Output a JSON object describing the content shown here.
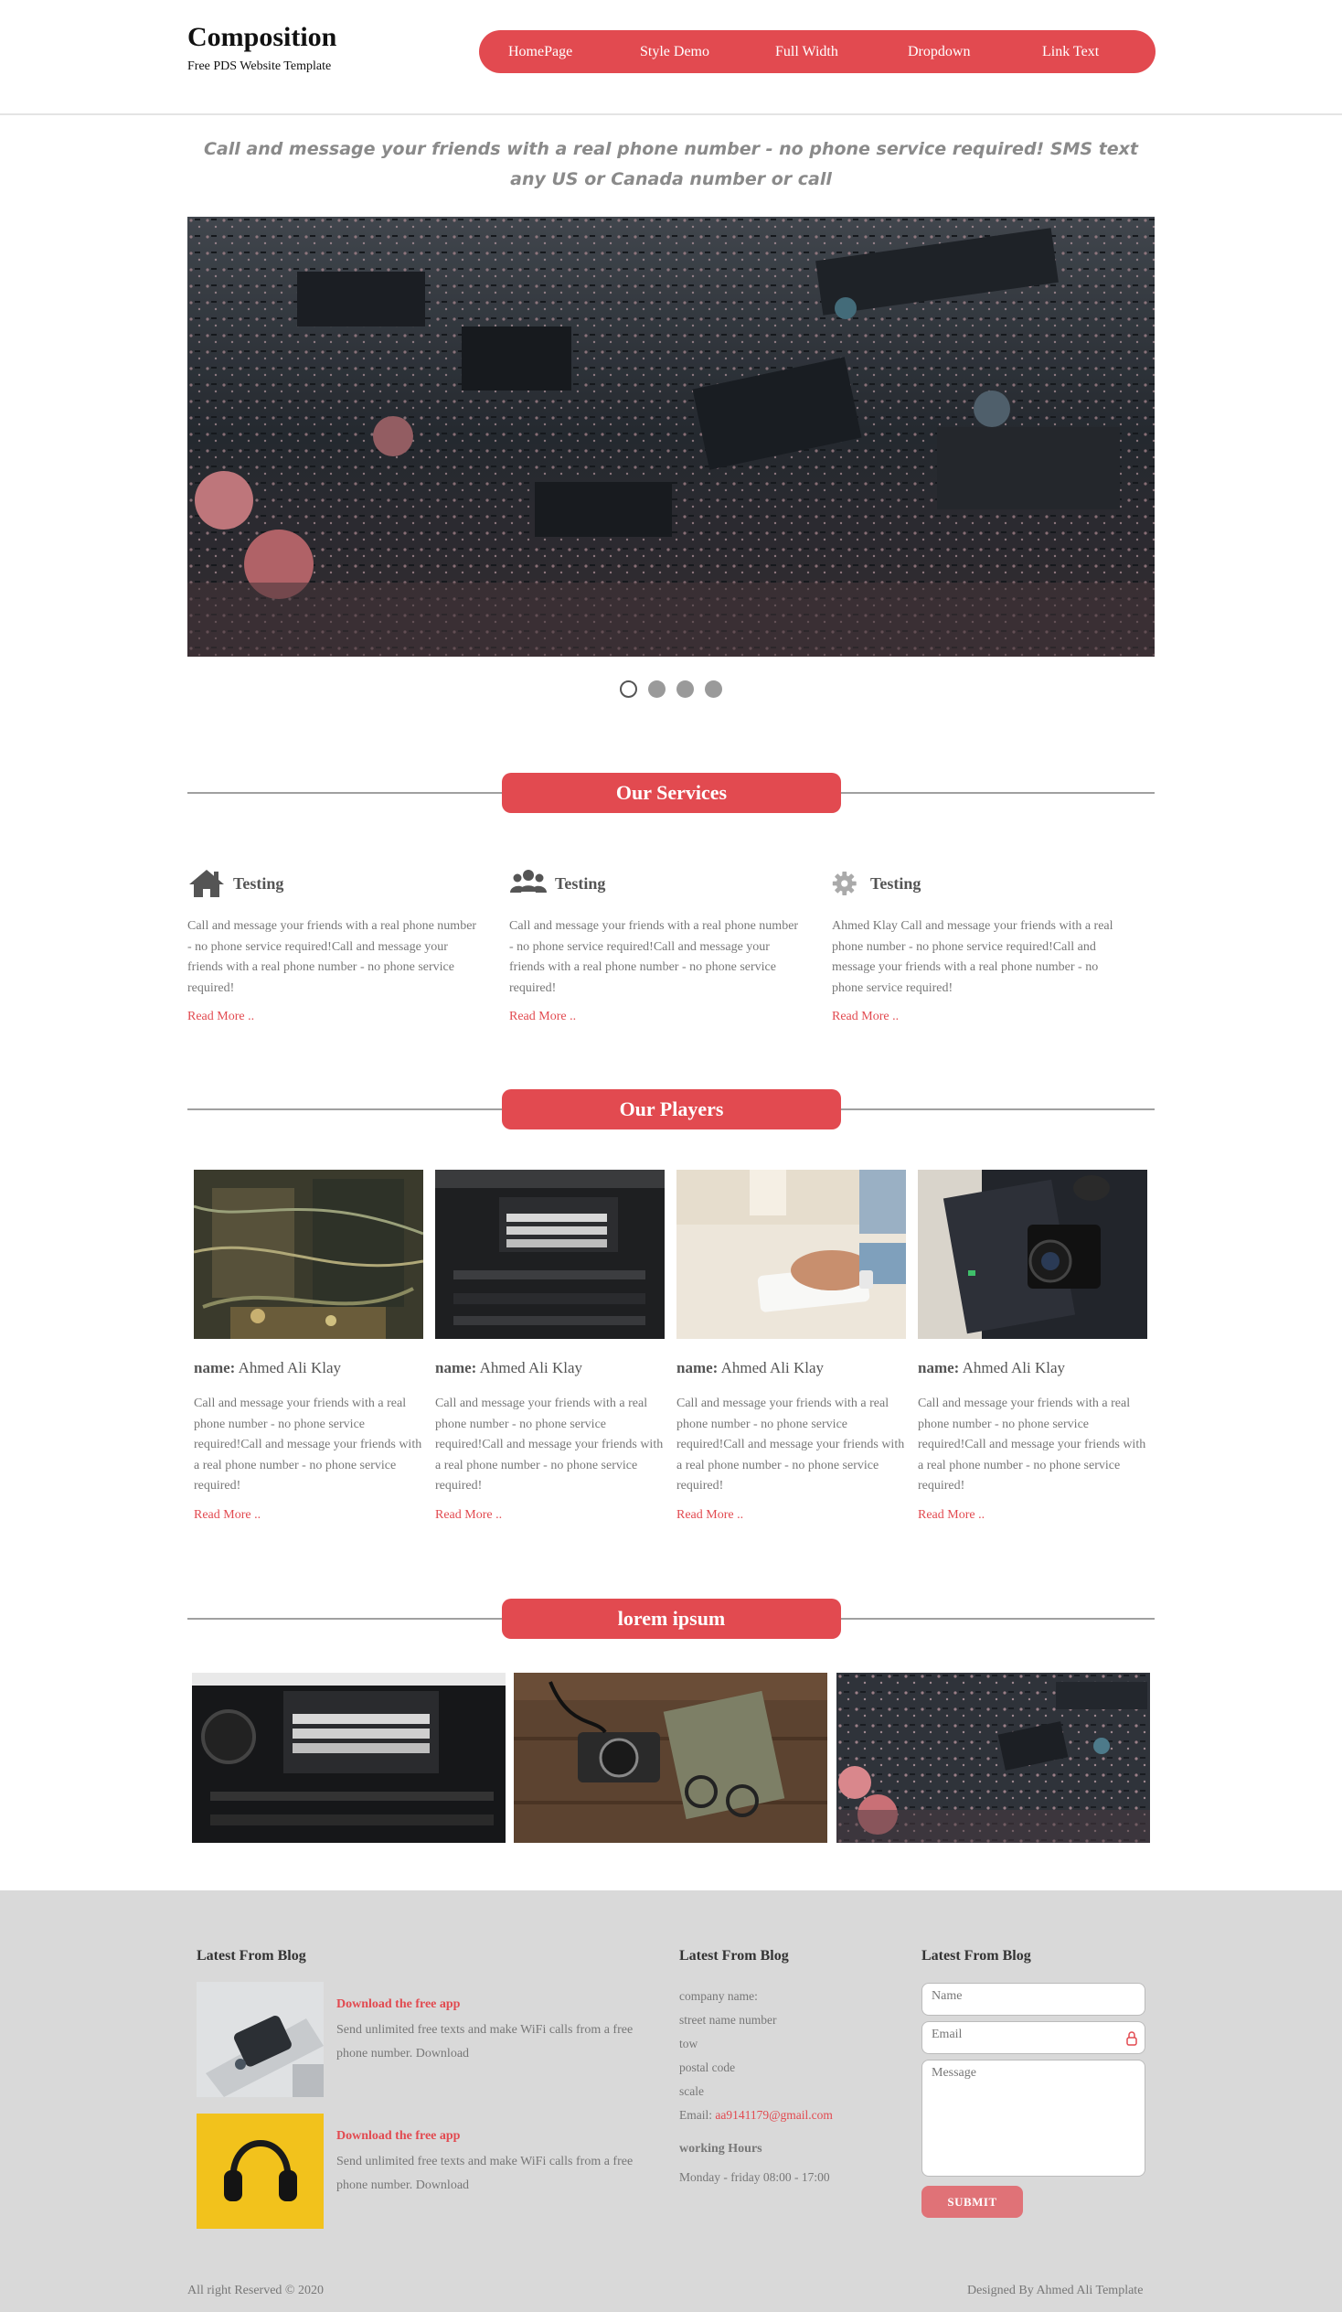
{
  "brand": {
    "title": "Composition",
    "subtitle": "Free PDS Website Template"
  },
  "nav": [
    "HomePage",
    "Style Demo",
    "Full Width",
    "Dropdown",
    "Link Text"
  ],
  "tagline": "Call and message your friends with a real phone number - no phone service required! SMS text any US or Canada number or call",
  "slider": {
    "dots": 4,
    "active_index": 0
  },
  "services": {
    "heading": "Our Services",
    "items": [
      {
        "icon": "home-icon",
        "title": "Testing",
        "text": "Call and message your friends with a real phone number - no phone service required!Call and message your friends with a real phone number - no phone service required!",
        "link": "Read More .."
      },
      {
        "icon": "users-icon",
        "title": "Testing",
        "text": "Call and message your friends with a real phone number - no phone service required!Call and message your friends with a real phone number - no phone service required!",
        "link": "Read More .."
      },
      {
        "icon": "gear-icon",
        "title": "Testing",
        "text": "Ahmed Klay Call and message your friends with a real phone number - no phone service required!Call and message your friends with a real phone number - no phone service required!",
        "link": "Read More .."
      }
    ]
  },
  "players": {
    "heading": "Our Players",
    "items": [
      {
        "label": "name:",
        "name": "Ahmed Ali Klay",
        "text": "Call and message your friends with a real phone number - no phone service required!Call and message your friends with a real phone number - no phone service required!",
        "link": "Read More .."
      },
      {
        "label": "name:",
        "name": "Ahmed Ali Klay",
        "text": "Call and message your friends with a real phone number - no phone service required!Call and message your friends with a real phone number - no phone service required!",
        "link": "Read More .."
      },
      {
        "label": "name:",
        "name": "Ahmed Ali Klay",
        "text": "Call and message your friends with a real phone number - no phone service required!Call and message your friends with a real phone number - no phone service required!",
        "link": "Read More .."
      },
      {
        "label": "name:",
        "name": "Ahmed Ali Klay",
        "text": "Call and message your friends with a real phone number - no phone service required!Call and message your friends with a real phone number - no phone service required!",
        "link": "Read More .."
      }
    ]
  },
  "gallery": {
    "heading": "lorem ipsum"
  },
  "footer": {
    "blog": {
      "heading": "Latest From Blog",
      "posts": [
        {
          "title": "Download the free app",
          "text": "Send unlimited free texts and make WiFi calls from a free phone number. Download"
        },
        {
          "title": "Download the free app",
          "text": "Send unlimited free texts and make WiFi calls from a free phone number. Download"
        }
      ]
    },
    "contact": {
      "heading": "Latest From Blog",
      "lines": [
        "company name:",
        "street name number",
        "tow",
        "postal code",
        "scale"
      ],
      "email_label": "Email:",
      "email": "aa9141179@gmail.com",
      "hours_heading": "working Hours",
      "hours": "Monday - friday 08:00 - 17:00"
    },
    "form": {
      "heading": "Latest From Blog",
      "name_placeholder": "Name",
      "email_placeholder": "Email",
      "message_placeholder": "Message",
      "submit": "SUBMIT"
    },
    "copyright": "All right Reserved © 2020",
    "credit": "Designed By Ahmed Ali Template"
  },
  "colors": {
    "accent": "#e24a50",
    "footer_bg": "#d9d9d9",
    "submit": "#e07277"
  }
}
